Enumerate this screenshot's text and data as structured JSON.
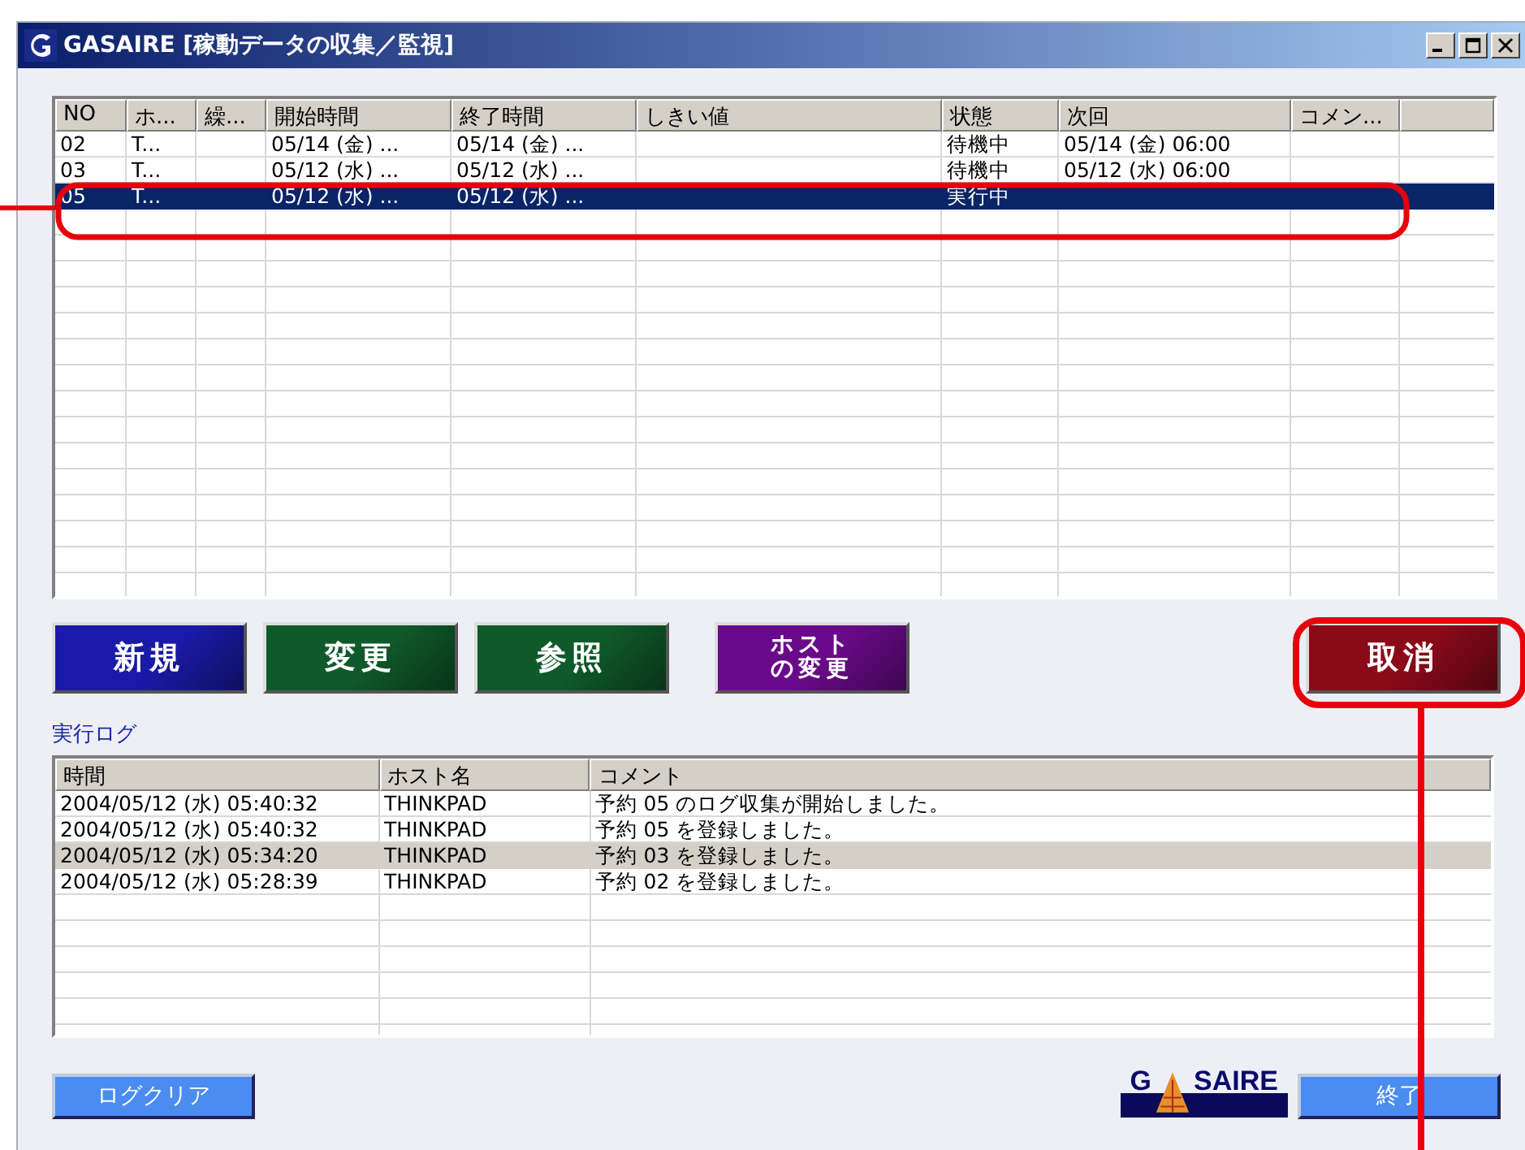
{
  "window": {
    "title": "GASAIRE [稼動データの収集／監視]",
    "controls": [
      {
        "kind": "minimize"
      },
      {
        "kind": "maximize"
      },
      {
        "kind": "close"
      }
    ]
  },
  "schedule_table": {
    "columns": [
      "NO",
      "ホ...",
      "繰...",
      "開始時間",
      "終了時間",
      "しきい値",
      "状態",
      "次回",
      "コメン..."
    ],
    "rows": [
      {
        "selected": false,
        "cells": [
          "02",
          "T...",
          "",
          "05/14 (金) ...",
          "05/14 (金) ...",
          "",
          "待機中",
          "05/14 (金) 06:00",
          ""
        ]
      },
      {
        "selected": false,
        "cells": [
          "03",
          "T...",
          "",
          "05/12 (水) ...",
          "05/12 (水) ...",
          "",
          "待機中",
          "05/12 (水) 06:00",
          ""
        ]
      },
      {
        "selected": true,
        "cells": [
          "05",
          "T...",
          "",
          "05/12 (水) ...",
          "05/12 (水) ...",
          "",
          "実行中",
          "",
          ""
        ]
      }
    ]
  },
  "action_buttons": [
    {
      "label": "新規",
      "color": "#1a1aa8"
    },
    {
      "label": "変更",
      "color": "#0f5a2a"
    },
    {
      "label": "参照",
      "color": "#0f5a2a"
    },
    {
      "label": "ホストの変更",
      "color": "#6a0a8a",
      "kind": "two_line"
    },
    {
      "label": "取消",
      "color": "#8a0a1a"
    }
  ],
  "log": {
    "label": "実行ログ",
    "columns": [
      "時間",
      "ホスト名",
      "コメント"
    ],
    "rows": [
      {
        "selected": false,
        "cells": [
          "2004/05/12 (水) 05:40:32",
          "THINKPAD",
          "予約 05 のログ収集が開始しました。"
        ]
      },
      {
        "selected": false,
        "cells": [
          "2004/05/12 (水) 05:40:32",
          "THINKPAD",
          "予約 05 を登録しました。"
        ]
      },
      {
        "selected": true,
        "cells": [
          "2004/05/12 (水) 05:34:20",
          "THINKPAD",
          "予約 03 を登録しました。"
        ]
      },
      {
        "selected": false,
        "cells": [
          "2004/05/12 (水) 05:28:39",
          "THINKPAD",
          "予約 02 を登録しました。"
        ]
      }
    ]
  },
  "bottom": {
    "clear_button": "ログクリア",
    "logo": [
      "G",
      "SAIRE"
    ],
    "exit_button": "終了"
  }
}
